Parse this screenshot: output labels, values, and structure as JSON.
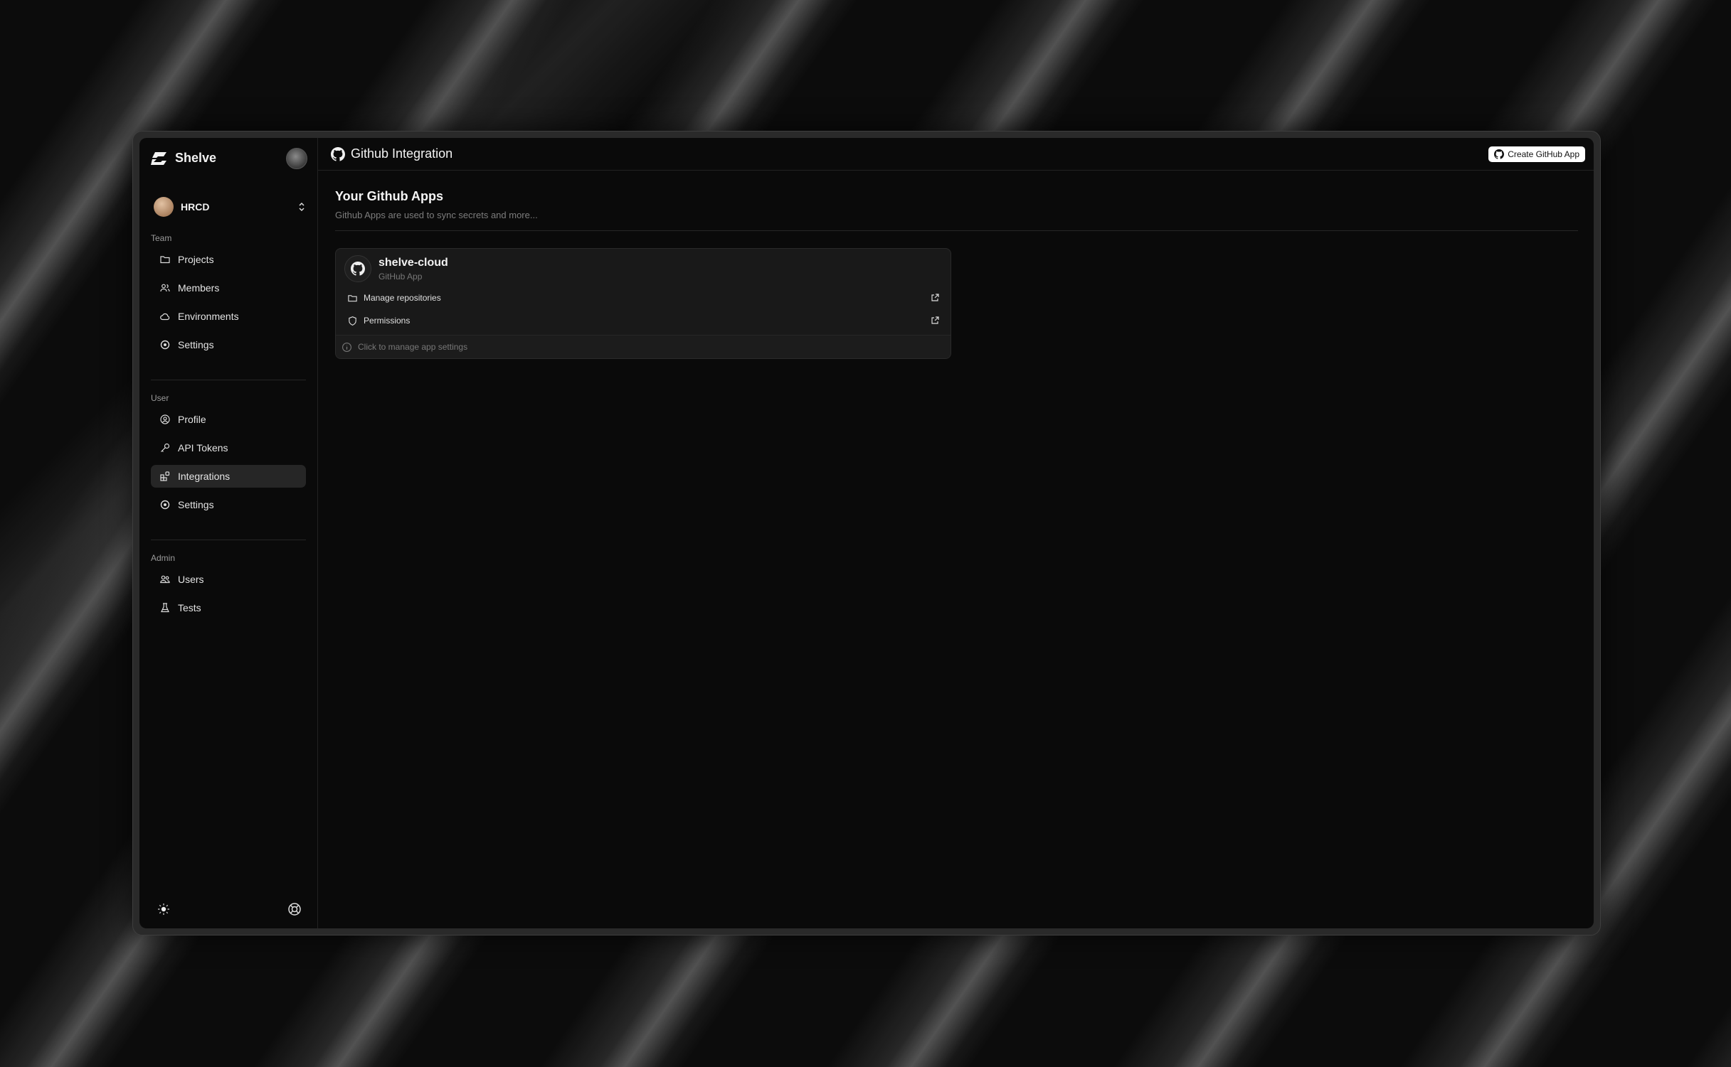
{
  "app": {
    "brand": "Shelve"
  },
  "team": {
    "name": "HRCD"
  },
  "sidebar": {
    "sections": [
      {
        "label": "Team",
        "items": [
          {
            "label": "Projects",
            "icon": "folder-icon"
          },
          {
            "label": "Members",
            "icon": "users-icon"
          },
          {
            "label": "Environments",
            "icon": "cloud-icon"
          },
          {
            "label": "Settings",
            "icon": "settings-icon"
          }
        ]
      },
      {
        "label": "User",
        "items": [
          {
            "label": "Profile",
            "icon": "user-circle-icon"
          },
          {
            "label": "API Tokens",
            "icon": "key-icon"
          },
          {
            "label": "Integrations",
            "icon": "integrations-icon",
            "active": true
          },
          {
            "label": "Settings",
            "icon": "settings-icon"
          }
        ]
      },
      {
        "label": "Admin",
        "items": [
          {
            "label": "Users",
            "icon": "users-group-icon"
          },
          {
            "label": "Tests",
            "icon": "flask-icon"
          }
        ]
      }
    ],
    "footer": {
      "theme_icon": "sun-icon",
      "help_icon": "lifebuoy-icon"
    }
  },
  "header": {
    "title": "Github Integration",
    "create_button": "Create GitHub App"
  },
  "main": {
    "heading": "Your Github Apps",
    "subheading": "Github Apps are used to sync secrets and more...",
    "apps": [
      {
        "name": "shelve-cloud",
        "type": "GitHub App",
        "actions": [
          {
            "label": "Manage repositories",
            "icon": "folder-icon"
          },
          {
            "label": "Permissions",
            "icon": "shield-icon"
          }
        ],
        "footer": "Click to manage app settings"
      }
    ]
  }
}
